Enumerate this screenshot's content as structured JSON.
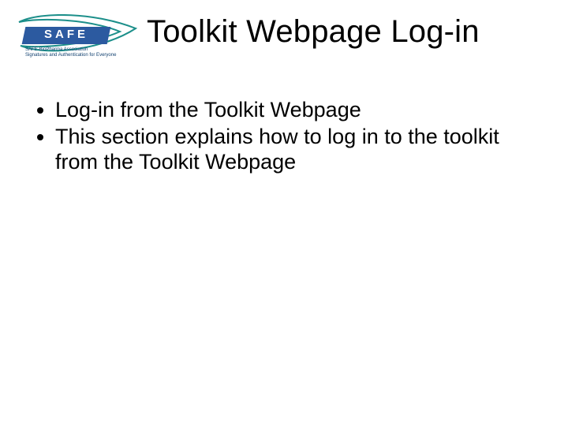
{
  "logo": {
    "main": "SAFE",
    "sub_line1": "SAFE-BioPharma Association",
    "sub_line2": "Signatures and Authentication for Everyone"
  },
  "title": "Toolkit Webpage Log-in",
  "bullets": [
    "Log-in from the Toolkit Webpage",
    "This section explains how to log in to the toolkit from the Toolkit Webpage"
  ]
}
